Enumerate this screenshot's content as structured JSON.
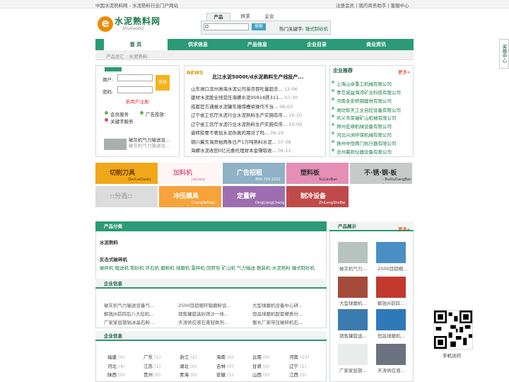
{
  "topbar": {
    "home_text": "中国水泥熟料网 - 水泥熟料行业门户网站",
    "right_text": "注册会员  |  我的商务助手  |  客服中心"
  },
  "header": {
    "logo_letter": "e",
    "logo_cn": "水泥熟料网",
    "logo_en": "Shuliaobiz",
    "search_tabs": [
      "产品",
      "供求",
      "企业"
    ],
    "search_placeholder": "",
    "search_button": "搜索",
    "hot_label": "热门关键字:",
    "hot_keyword": "锤式制砂机"
  },
  "nav": {
    "items": [
      "首 页",
      "供求信息",
      "产品信息",
      "企业目录",
      "商业资讯"
    ]
  },
  "breadcrumb": "产品总汇 : 水泥熟料",
  "login": {
    "user_label": "用户:",
    "pass_label": "密码:",
    "login_button": "登录",
    "register_link": "新用户注册",
    "services": [
      "会员服务",
      "广告投放",
      "关键字服务"
    ],
    "promo_title": "破灰机气力输送设...",
    "promo_sub": "破灰机气力输送设..."
  },
  "news": {
    "tag": "NEWS",
    "headline": "北江水泥5000t/d水泥熟料生产线投产...",
    "items": [
      {
        "text": "山东潍口滨州潍海水泥公司单月吞吐量超去...",
        "date": "12-06"
      },
      {
        "text": "建材水泥股全线受压海螺水泥00914跌311...",
        "date": "07-30"
      },
      {
        "text": "成都官方通报水泥罐车撞塌槽梁操作不当...",
        "date": "06-03"
      },
      {
        "text": "辽宁省工信厅水泥行业水泥熟料生产实施有序...",
        "date": "10-10"
      },
      {
        "text": "辽宁省工信厅水泥行业水泥熟料生产实施有序...",
        "date": "10-09"
      },
      {
        "text": "姿砖胶要不要加水泥你真的用对了吗...",
        "date": "09-29"
      },
      {
        "text": "铜川冀东海贡柏两条日产1万吨熟料水泥...",
        "date": "07-08"
      },
      {
        "text": "海螺水泥收回0亿元委托理财本金赚取收...",
        "date": "06-11"
      }
    ]
  },
  "recommend": {
    "title": "企业推荐",
    "more": "更多»",
    "items": [
      "上海山卓重工机械有限公司",
      "青岛诚益海湾矿业科技有限公司",
      "河南永安桥钢建材有限公司",
      "潍坊智天工业自控设备有限公司",
      "巩义市荣瑞矿山机械有限公司",
      "郑州宏顺机械设备有限公司",
      "河北兴洲环保机械有限公司",
      "扬州中恒两门执行器有限公司",
      "沧州晨骅仪器设备有限公司"
    ]
  },
  "banners": [
    {
      "text": "切削刀具",
      "sub": "QieXueDaoJu",
      "color": "#f0a81a",
      "text_color": "#6b3a00"
    },
    {
      "text": "加料机",
      "sub": "JiaLiaoJi",
      "color": "#fff6f6",
      "text_color": "#d96a8e"
    },
    {
      "text": "广告招租",
      "sub": "400-703-2221",
      "color": "#8fb2c6",
      "text_color": "#ffffff"
    },
    {
      "text": "塑料板",
      "sub": "SuLiaoBan",
      "color": "#e58fb4",
      "text_color": "#333333"
    },
    {
      "text": "不·锈·钢·板",
      "sub": "- BuXiuGangBan -",
      "color": "#c6cac8",
      "text_color": "#333333"
    },
    {
      "text": "::分选::",
      "sub": "",
      "color": "#dcdcdc",
      "text_color": "#aaaaaa"
    },
    {
      "text": "冲压模具",
      "sub": "ChongYaMoJu",
      "color": "#f6a33a",
      "text_color": "#ffffff"
    },
    {
      "text": "定量秤",
      "sub": "DingLiangCheng",
      "color": "#9d6fb0",
      "text_color": "#ffffff"
    },
    {
      "text": "制冷设备",
      "sub": "ZhiLengSheBei",
      "color": "#c04a4a",
      "text_color": "#ffffff"
    }
  ],
  "category": {
    "title": "产品分类",
    "level1": "水泥熟料",
    "level2": "反击式破碎机",
    "tags": "破碎机  辊送机  制砂机  环石机  磨粉机  球磨机  雷碎机  回转窑  矿山机  气力输送  数装机  水泥熟料  锤式制砂机"
  },
  "enterprise": {
    "title": "企业信息",
    "items": [
      "破灰机气力输送设备气...",
      "2500目超细环辊磨粉设...",
      "大型球磨机设备中心研...",
      "解放J6前四后八大挖机...",
      "销售罐旋选砂筛沙一体...",
      "恒昌球磨机配套硬质分...",
      "广家家层颚钠冰晶石粉...",
      "天涛供应液石膏轻致剂...",
      "衡水厂家带压破碎机石..."
    ]
  },
  "region": {
    "title": "企业信息",
    "items": [
      {
        "name": "福建",
        "count": "(0)"
      },
      {
        "name": "广东",
        "count": "(1)"
      },
      {
        "name": "浙江",
        "count": "(2)"
      },
      {
        "name": "海南",
        "count": "(0)"
      },
      {
        "name": "云南",
        "count": "(0)"
      },
      {
        "name": "河南",
        "count": "(15)"
      },
      {
        "name": "河北",
        "count": "(4)"
      },
      {
        "name": "江苏",
        "count": "(1)"
      },
      {
        "name": "湖北",
        "count": "(0)"
      },
      {
        "name": "吉林",
        "count": "(0)"
      },
      {
        "name": "甘肃",
        "count": "(0)"
      },
      {
        "name": "辽宁",
        "count": "(1)"
      },
      {
        "name": "陕西",
        "count": "(0)"
      },
      {
        "name": "贵州",
        "count": "(0)"
      },
      {
        "name": "青海",
        "count": "(0)"
      },
      {
        "name": "安徽",
        "count": "(1)"
      },
      {
        "name": "山西",
        "count": "(0)"
      },
      {
        "name": "江西",
        "count": "(0)"
      }
    ]
  },
  "products": {
    "title": "产品展示",
    "more": "更多»",
    "items": [
      {
        "caption": "破灰机气力...",
        "color": "#b7c3be"
      },
      {
        "caption": "2500目超细...",
        "color": "#4a8fc4"
      },
      {
        "caption": "大型球磨机...",
        "color": "#a44b3a"
      },
      {
        "caption": "解放J6前四...",
        "color": "#c23a2e"
      },
      {
        "caption": "销售罐旋选...",
        "color": "#3a7bb0"
      },
      {
        "caption": "恒昌球磨机...",
        "color": "#2f79b8"
      },
      {
        "caption": "广家家层颚...",
        "color": "#e8ecea"
      },
      {
        "caption": "天涛供应液...",
        "color": "#6b7280"
      }
    ]
  },
  "side": {
    "service_tab": "客服中心",
    "qr_label": "手机访问"
  }
}
